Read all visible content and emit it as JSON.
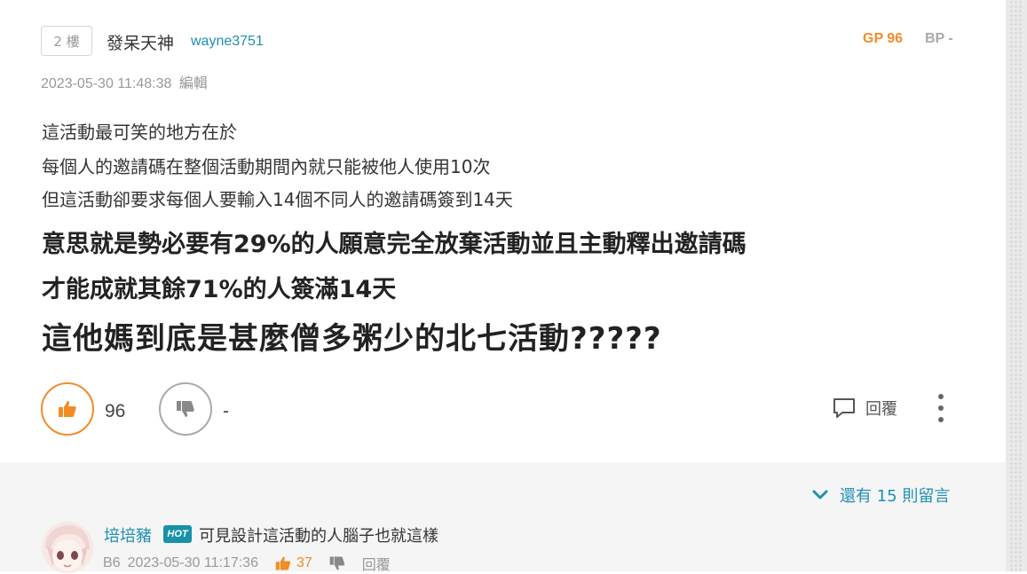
{
  "post": {
    "floor": "2 樓",
    "author_name": "發呆天神",
    "author_id": "wayne3751",
    "gp": "GP 96",
    "bp": "BP -",
    "timestamp": "2023-05-30 11:48:38",
    "edit_label": "編輯",
    "lines": [
      "這活動最可笑的地方在於",
      "每個人的邀請碼在整個活動期間內就只能被他人使用10次",
      "但這活動卻要求每個人要輸入14個不同人的邀請碼簽到14天",
      "意思就是勢必要有29%的人願意完全放棄活動並且主動釋出邀請碼",
      "才能成就其餘71%的人簽滿14天",
      "這他媽到底是甚麼僧多粥少的北七活動?????"
    ],
    "up_count": "96",
    "down_count": "-",
    "reply_label": "回覆"
  },
  "comments": {
    "more_label": "還有 15 則留言",
    "items": [
      {
        "author": "培培豬",
        "badge": "HOT",
        "text": "可見設計這活動的人腦子也就這樣",
        "floor": "B6",
        "time": "2023-05-30 11:17:36",
        "likes": "37",
        "reply_label": "回覆"
      }
    ]
  },
  "colors": {
    "accent_orange": "#f28c28",
    "link_blue": "#1f8fb3",
    "hot_badge": "#1792a8"
  }
}
